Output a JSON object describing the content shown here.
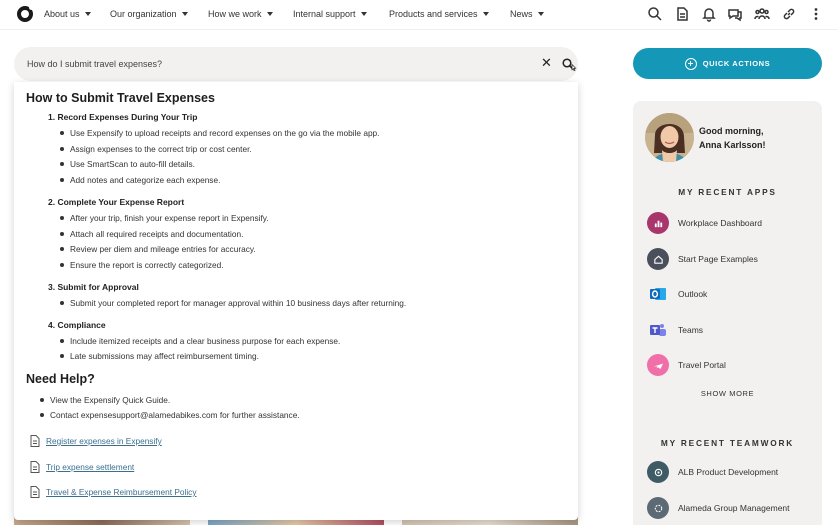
{
  "nav": {
    "items": [
      {
        "label": "About us"
      },
      {
        "label": "Our organization"
      },
      {
        "label": "How we work"
      },
      {
        "label": "Internal support"
      },
      {
        "label": "Products and services"
      },
      {
        "label": "News"
      }
    ],
    "icons": [
      "search-icon",
      "document-icon",
      "bell-icon",
      "chat-icon",
      "people-icon",
      "link-icon",
      "more-vertical-icon"
    ]
  },
  "search": {
    "value": "How do I submit travel expenses?"
  },
  "results": {
    "title": "How to Submit Travel Expenses",
    "sections": [
      {
        "heading": "1. Record Expenses During Your Trip",
        "bullets": [
          "Use Expensify to upload receipts and record expenses on the go via the mobile app.",
          "Assign expenses to the correct trip or cost center.",
          "Use SmartScan to auto-fill details.",
          "Add notes and categorize each expense."
        ]
      },
      {
        "heading": "2. Complete Your Expense Report",
        "bullets": [
          "After your trip, finish your expense report in Expensify.",
          "Attach all required receipts and documentation.",
          "Review per diem and mileage entries for accuracy.",
          "Ensure the report is correctly categorized."
        ]
      },
      {
        "heading": "3. Submit for Approval",
        "bullets": [
          "Submit your completed report for manager approval within 10 business days after returning."
        ]
      },
      {
        "heading": "4. Compliance",
        "bullets": [
          "Include itemized receipts and a clear business purpose for each expense.",
          "Late submissions may affect reimbursement timing."
        ]
      }
    ],
    "help_title": "Need Help?",
    "help_bullets": [
      "View the Expensify Quick Guide.",
      "Contact expensesupport@alamedabikes.com for further assistance."
    ],
    "links": [
      "Register expenses in Expensify",
      "Trip expense settlement",
      "Travel & Expense Reimbursement Policy"
    ]
  },
  "quick_actions": {
    "label": "QUICK ACTIONS"
  },
  "profile": {
    "greeting_line1": "Good morning,",
    "greeting_line2": "Anna Karlsson!"
  },
  "recent_apps": {
    "heading": "MY RECENT APPS",
    "items": [
      {
        "label": "Workplace Dashboard",
        "icon": "dashboard-icon",
        "color": "#a8356b"
      },
      {
        "label": "Start Page Examples",
        "icon": "home-icon",
        "color": "#4a4f5c"
      },
      {
        "label": "Outlook",
        "icon": "outlook-icon",
        "color": "#0f6cbd"
      },
      {
        "label": "Teams",
        "icon": "teams-icon",
        "color": "#5059c9"
      },
      {
        "label": "Travel Portal",
        "icon": "plane-icon",
        "color": "#f06fa8"
      }
    ],
    "show_more": "SHOW MORE"
  },
  "recent_teamwork": {
    "heading": "MY RECENT TEAMWORK",
    "items": [
      {
        "label": "ALB Product Development",
        "icon": "team-icon",
        "color": "#3e5b66"
      },
      {
        "label": "Alameda Group Management",
        "icon": "team-icon",
        "color": "#5b6a75"
      }
    ]
  },
  "colors": {
    "accent": "#1597b8",
    "link": "#3a6f8f",
    "panel_bg": "#f2f1ef"
  }
}
